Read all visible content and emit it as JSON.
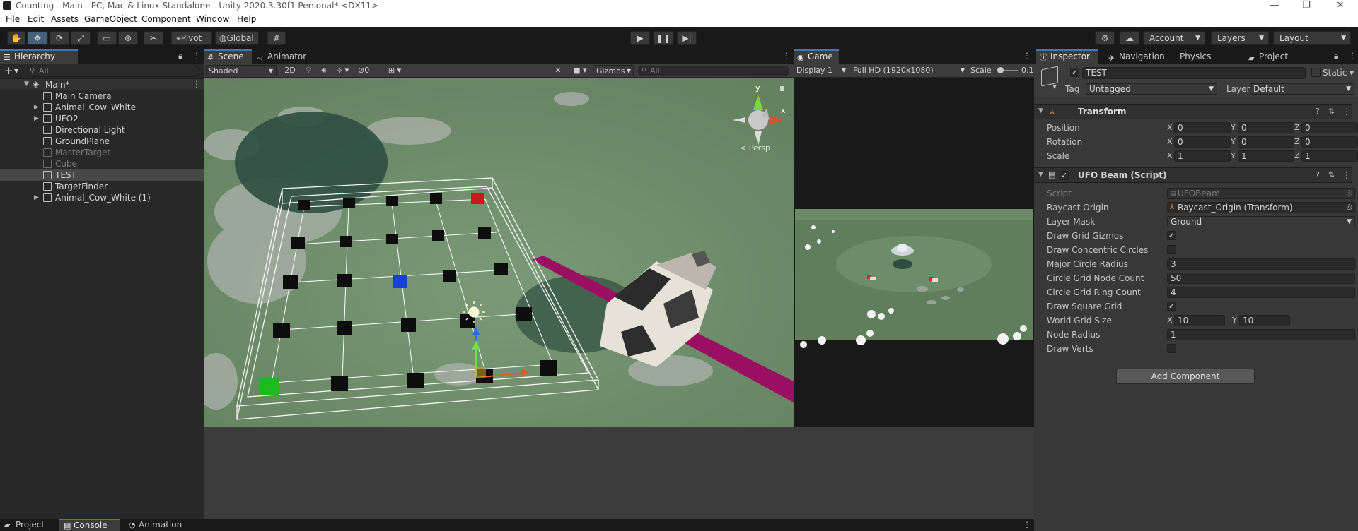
{
  "window": {
    "title": "Counting - Main - PC, Mac & Linux Standalone - Unity 2020.3.30f1 Personal* <DX11>",
    "controls": [
      "—",
      "❐",
      "✕"
    ]
  },
  "menu": [
    "File",
    "Edit",
    "Assets",
    "GameObject",
    "Component",
    "Window",
    "Help"
  ],
  "toolbar": {
    "pivot_label": "Pivot",
    "global_label": "Global",
    "account_label": "Account",
    "layers_label": "Layers",
    "layout_label": "Layout"
  },
  "hierarchy": {
    "tab_label": "Hierarchy",
    "search_placeholder": "All",
    "scene_name": "Main*",
    "items": [
      {
        "label": "Main Camera",
        "expandable": false,
        "dim": false,
        "selected": false
      },
      {
        "label": "Animal_Cow_White",
        "expandable": true,
        "dim": false,
        "selected": false
      },
      {
        "label": "UFO2",
        "expandable": true,
        "dim": false,
        "selected": false
      },
      {
        "label": "Directional Light",
        "expandable": false,
        "dim": false,
        "selected": false
      },
      {
        "label": "GroundPlane",
        "expandable": false,
        "dim": false,
        "selected": false
      },
      {
        "label": "MasterTarget",
        "expandable": false,
        "dim": true,
        "selected": false
      },
      {
        "label": "Cube",
        "expandable": false,
        "dim": true,
        "selected": false
      },
      {
        "label": "TEST",
        "expandable": false,
        "dim": false,
        "selected": true
      },
      {
        "label": "TargetFinder",
        "expandable": false,
        "dim": false,
        "selected": false
      },
      {
        "label": "Animal_Cow_White (1)",
        "expandable": true,
        "dim": false,
        "selected": false
      }
    ]
  },
  "scene": {
    "tabs": [
      "Scene",
      "Animator"
    ],
    "shading_mode": "Shaded",
    "mode_2d_label": "2D",
    "hidden_count": "0",
    "gizmos_label": "Gizmos",
    "search_placeholder": "All",
    "persp_label": "< Persp",
    "axis_labels": {
      "y": "y",
      "x": "x"
    }
  },
  "game": {
    "tab_label": "Game",
    "display": "Display 1",
    "resolution": "Full HD (1920x1080)",
    "scale_label": "Scale",
    "scale_value": "0.1"
  },
  "inspector": {
    "tabs": [
      "Inspector",
      "Navigation",
      "Physics Debug",
      "Project"
    ],
    "object_name": "TEST",
    "static_label": "Static",
    "tag_label": "Tag",
    "tag_value": "Untagged",
    "layer_label": "Layer",
    "layer_value": "Default",
    "transform": {
      "title": "Transform",
      "rows": [
        {
          "label": "Position",
          "x": "0",
          "y": "0",
          "z": "0"
        },
        {
          "label": "Rotation",
          "x": "0",
          "y": "0",
          "z": "0"
        },
        {
          "label": "Scale",
          "x": "1",
          "y": "1",
          "z": "1"
        }
      ]
    },
    "ufo_beam": {
      "title": "UFO Beam (Script)",
      "script_label": "Script",
      "script_value": "UFOBeam",
      "raycast_label": "Raycast Origin",
      "raycast_value": "Raycast_Origin (Transform)",
      "layermask_label": "Layer Mask",
      "layermask_value": "Ground",
      "draw_grid_gizmos_label": "Draw Grid Gizmos",
      "draw_grid_gizmos": true,
      "draw_concentric_label": "Draw Concentric Circles",
      "draw_concentric": false,
      "major_radius_label": "Major Circle Radius",
      "major_radius_value": "3",
      "node_count_label": "Circle Grid Node Count",
      "node_count_value": "50",
      "ring_count_label": "Circle Grid Ring Count",
      "ring_count_value": "4",
      "draw_square_label": "Draw Square Grid",
      "draw_square": true,
      "world_grid_label": "World Grid Size",
      "world_grid_x": "10",
      "world_grid_y": "10",
      "node_radius_label": "Node Radius",
      "node_radius_value": "1",
      "draw_verts_label": "Draw Verts",
      "draw_verts": false
    },
    "add_component_label": "Add Component"
  },
  "bottom": {
    "tabs": [
      "Project",
      "Console",
      "Animation"
    ]
  }
}
